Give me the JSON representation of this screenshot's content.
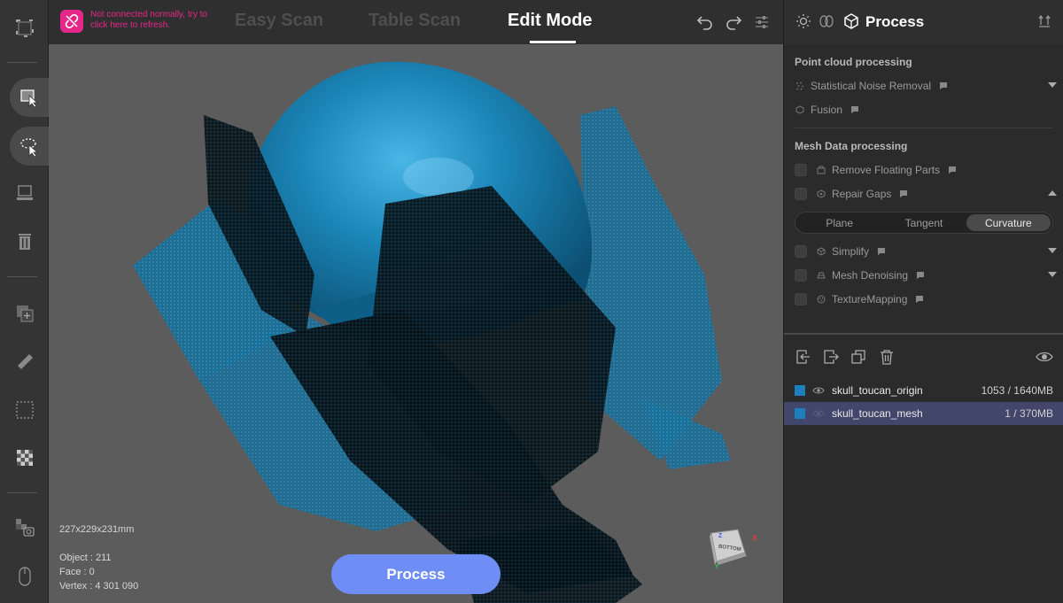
{
  "connection": {
    "message": "Not connected normally, try to click here to refresh."
  },
  "modes": {
    "easy_scan": "Easy Scan",
    "table_scan": "Table Scan",
    "edit_mode": "Edit Mode",
    "active": "edit_mode"
  },
  "viewport": {
    "dimensions": "227x229x231mm",
    "object_count": "Object : 211",
    "face_count": "Face : 0",
    "vertex_count": "Vertex : 4 301 090",
    "process_button": "Process",
    "view_cube_label": "BOTTOM",
    "axis_z": "Z",
    "axis_y": "Y",
    "axis_x": "X"
  },
  "panel": {
    "title": "Process",
    "point_cloud_section": "Point cloud processing",
    "point_cloud_items": [
      {
        "label": "Statistical Noise Removal",
        "icon": "scatter-dots-icon",
        "expand": "down"
      },
      {
        "label": "Fusion",
        "icon": "fusion-icon"
      }
    ],
    "mesh_section": "Mesh Data processing",
    "mesh_items": [
      {
        "label": "Remove Floating Parts",
        "icon": "floating-parts-icon",
        "checked": false
      },
      {
        "label": "Repair Gaps",
        "icon": "repair-gaps-icon",
        "checked": false,
        "expand": "up"
      },
      {
        "label": "Simplify",
        "icon": "simplify-icon",
        "checked": false,
        "expand": "down"
      },
      {
        "label": "Mesh Denoising",
        "icon": "mesh-denoise-icon",
        "checked": false,
        "expand": "down"
      },
      {
        "label": "TextureMapping",
        "icon": "texture-mapping-icon",
        "checked": false
      }
    ],
    "repair_modes": [
      "Plane",
      "Tangent",
      "Curvature"
    ],
    "repair_mode_selected": "Curvature"
  },
  "objects": [
    {
      "name": "skull_toucan_origin",
      "size": "1053 / 1640MB",
      "color": "#1d7ec0",
      "selected": false
    },
    {
      "name": "skull_toucan_mesh",
      "size": "1 / 370MB",
      "color": "#1d7ec0",
      "selected": true
    }
  ],
  "colors": {
    "accent": "#6f8ef5",
    "warning": "#e6278a",
    "model_blue": "#1b86b8",
    "selection": "#41466a"
  }
}
